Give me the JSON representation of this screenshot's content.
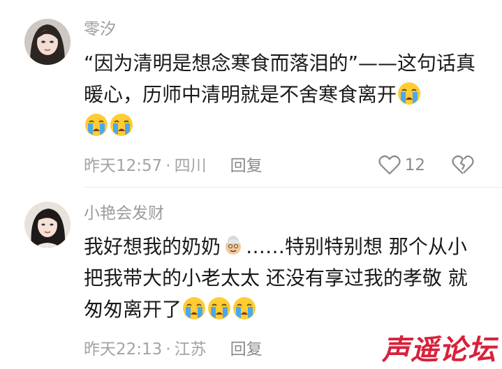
{
  "comments": [
    {
      "username": "零汐",
      "text_before": "“因为清明是想念寒食而落泪的”——这句话真暖心，历师中清明就是不舍寒食离开",
      "emoji_count": 3,
      "emoji_name": "loudly-crying-face-icon",
      "time": "昨天12:57",
      "separator": "·",
      "location": "四川",
      "reply_label": "回复",
      "like_count": "12"
    },
    {
      "username": "小艳会发财",
      "text_before": "我好想我的奶奶",
      "inline_emoji_name": "old-woman-icon",
      "text_after": "……特别特别想 那个从小把我带大的小老太太 还没有享过我的孝敬 就匆匆离开了",
      "emoji_count": 3,
      "emoji_name": "loudly-crying-face-icon",
      "time": "昨天22:13",
      "separator": "·",
      "location": "江苏",
      "reply_label": "回复"
    }
  ],
  "watermark": "声遥论坛",
  "colors": {
    "meta": "#a3a3a3",
    "username": "#9b9b9b",
    "watermark": "#d8213b"
  }
}
